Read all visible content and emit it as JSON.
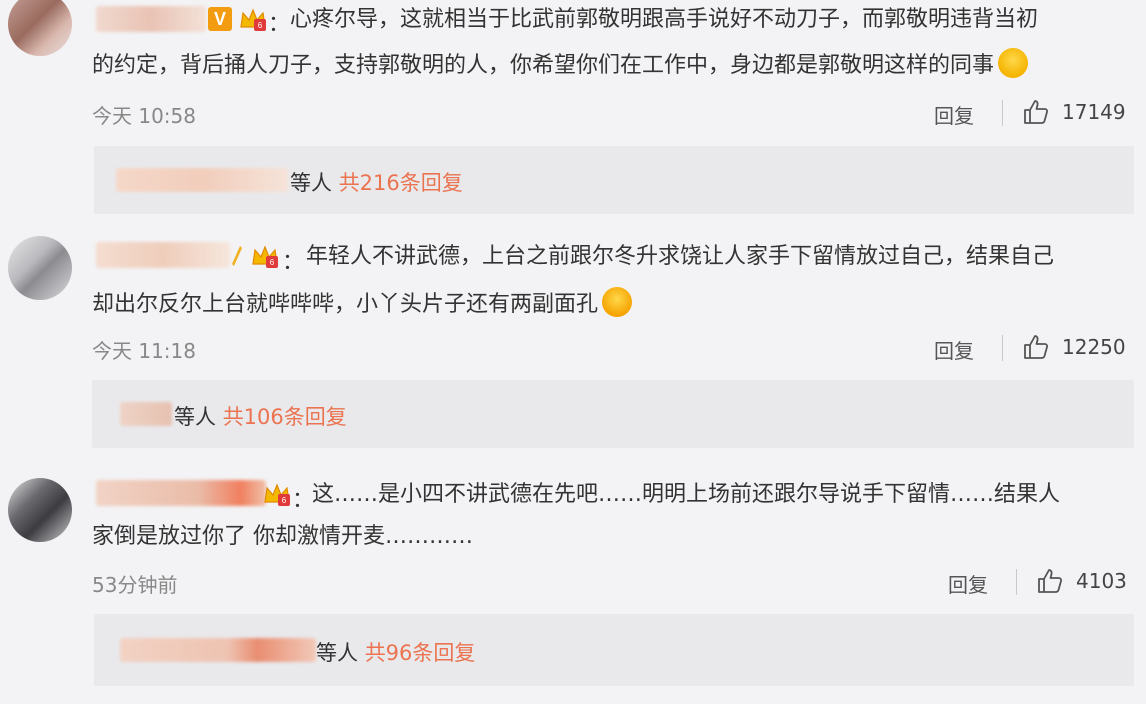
{
  "comments": [
    {
      "text_line1": "心疼尔导，这就相当于比武前郭敬明跟高手说好不动刀子，而郭敬明违背当初",
      "text_line2": "的约定，背后捅人刀子，支持郭敬明的人，你希望你们在工作中，身边都是郭敬明这样的同事",
      "badge": "V",
      "time": "今天 10:58",
      "reply_label": "回复",
      "likes": "17149",
      "replies_prefix": "等人",
      "replies_count": "共216条回复",
      "emoji": "hug-emoji"
    },
    {
      "text_line1": "年轻人不讲武德，上台之前跟尔冬升求饶让人家手下留情放过自己，结果自己",
      "text_line2": "却出尔反尔上台就哔哔哔，小丫头片子还有两副面孔",
      "time": "今天 11:18",
      "reply_label": "回复",
      "likes": "12250",
      "replies_prefix": "等人",
      "replies_count": "共106条回复",
      "emoji": "tongue-emoji"
    },
    {
      "text_line1": "这……是小四不讲武德在先吧……明明上场前还跟尔导说手下留情……结果人",
      "text_line2": "家倒是放过你了 你却激情开麦…………",
      "time": "53分钟前",
      "reply_label": "回复",
      "likes": "4103",
      "replies_prefix": "等人",
      "replies_count": "共96条回复"
    }
  ],
  "colon": "：",
  "colors": {
    "background": "#f3f3f5",
    "reply_box": "#e9e9ec",
    "accent": "#eb7350",
    "muted": "#888888"
  }
}
